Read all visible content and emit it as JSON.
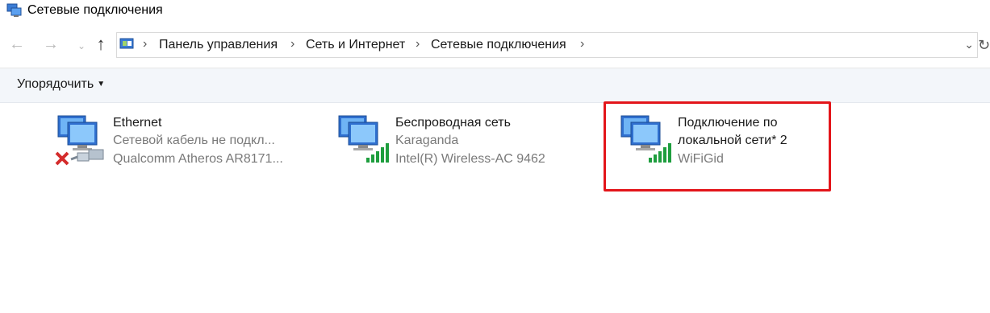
{
  "window": {
    "title": "Сетевые подключения"
  },
  "nav": {
    "back_icon": "arrow-left-icon",
    "forward_icon": "arrow-right-icon",
    "up_icon": "arrow-up-icon",
    "breadcrumbs": [
      "Панель управления",
      "Сеть и Интернет",
      "Сетевые подключения"
    ]
  },
  "toolbar": {
    "organize_label": "Упорядочить"
  },
  "connections": [
    {
      "name": "Ethernet",
      "status": "Сетевой кабель не подкл...",
      "adapter": "Qualcomm Atheros AR8171..."
    },
    {
      "name": "Беспроводная сеть",
      "status": "Karaganda",
      "adapter": "Intel(R) Wireless-AC 9462"
    },
    {
      "name_line1": "Подключение по",
      "name_line2": "локальной сети* 2",
      "status": "WiFiGid"
    }
  ],
  "colors": {
    "highlight": "#e3151a",
    "signal": "#1e9e3e",
    "error": "#d42b2b"
  }
}
